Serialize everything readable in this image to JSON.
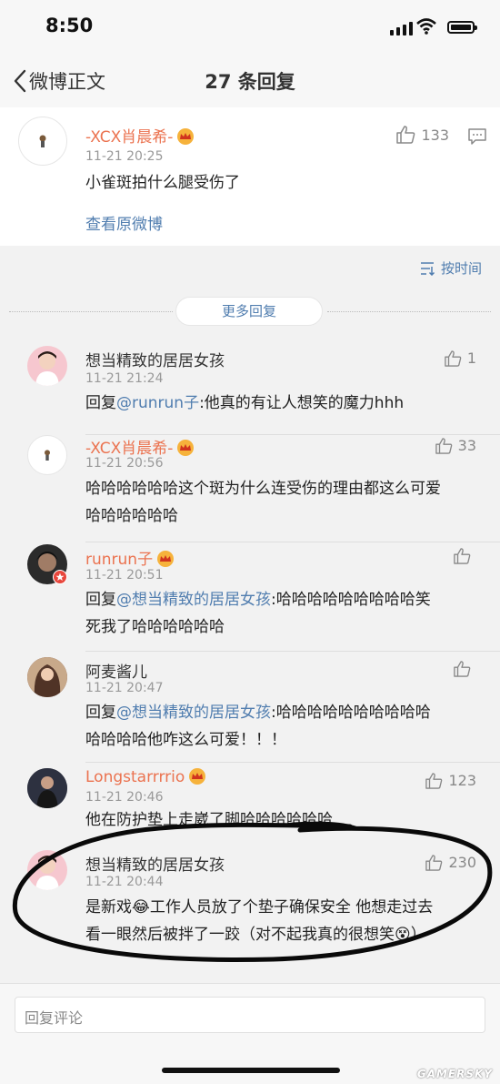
{
  "status": {
    "time": "8:50"
  },
  "nav": {
    "back_label": "微博正文",
    "title": "27 条回复"
  },
  "original": {
    "author": "-XCX肖晨希-",
    "time": "11-21 20:25",
    "likes": "133",
    "content": "小雀斑拍什么腿受伤了",
    "view_original": "查看原微博"
  },
  "sort_label": "按时间",
  "more_replies": "更多回复",
  "replies": [
    {
      "author": "想当精致的居居女孩",
      "time": "11-21 21:24",
      "likes": "1",
      "prefix": "回复",
      "mention": "@runrun子",
      "text": ":他真的有让人想笑的魔力hhh",
      "text_line2": ""
    },
    {
      "author": "-XCX肖晨希-",
      "time": "11-21 20:56",
      "likes": "33",
      "prefix": "",
      "mention": "",
      "text": "哈哈哈哈哈哈这个斑为什么连受伤的理由都这么可爱",
      "text_line2": "哈哈哈哈哈哈"
    },
    {
      "author": "runrun子",
      "time": "11-21 20:51",
      "likes": "",
      "prefix": "回复",
      "mention": "@想当精致的居居女孩",
      "text": ":哈哈哈哈哈哈哈哈哈笑",
      "text_line2": "死我了哈哈哈哈哈哈"
    },
    {
      "author": "阿麦酱儿",
      "time": "11-21 20:47",
      "likes": "",
      "prefix": "回复",
      "mention": "@想当精致的居居女孩",
      "text": ":哈哈哈哈哈哈哈哈哈哈",
      "text_line2": "哈哈哈哈他咋这么可爱！！！"
    },
    {
      "author": "Longstarrrrio",
      "time": "11-21 20:46",
      "likes": "123",
      "prefix": "",
      "mention": "",
      "text": "他在防护垫上走崴了脚哈哈哈哈哈哈",
      "text_line2": ""
    },
    {
      "author": "想当精致的居居女孩",
      "time": "11-21 20:44",
      "likes": "230",
      "prefix": "",
      "mention": "",
      "text": "是新戏😂工作人员放了个垫子确保安全 他想走过去",
      "text_line2": "看一眼然后被拌了一跤（对不起我真的很想笑😵）"
    }
  ],
  "input_placeholder": "回复评论",
  "watermark": "GAMERSKY",
  "colors": {
    "accent_orange": "#eb7350",
    "link_blue": "#507daf",
    "background": "#f2f2f2"
  }
}
